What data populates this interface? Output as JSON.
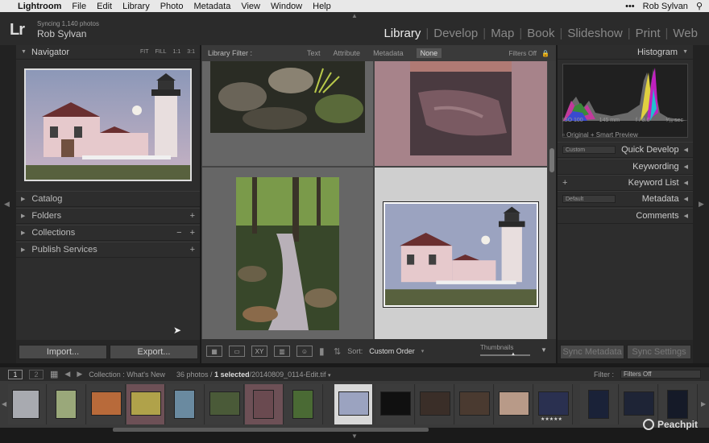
{
  "menubar": {
    "app_name": "Lightroom",
    "items": [
      "File",
      "Edit",
      "Library",
      "Photo",
      "Metadata",
      "View",
      "Window",
      "Help"
    ],
    "user": "Rob Sylvan"
  },
  "identity": {
    "sync_status": "Syncing 1,140 photos",
    "user_name": "Rob Sylvan",
    "logo": "Lr"
  },
  "modules": [
    "Library",
    "Develop",
    "Map",
    "Book",
    "Slideshow",
    "Print",
    "Web"
  ],
  "active_module": "Library",
  "left_panel": {
    "navigator_title": "Navigator",
    "zoom_options": [
      "FIT",
      "FILL",
      "1:1",
      "3:1"
    ],
    "sections": [
      {
        "label": "Catalog"
      },
      {
        "label": "Folders"
      },
      {
        "label": "Collections"
      },
      {
        "label": "Publish Services"
      }
    ],
    "import_label": "Import...",
    "export_label": "Export..."
  },
  "filter_bar": {
    "label": "Library Filter :",
    "options": [
      "Text",
      "Attribute",
      "Metadata",
      "None"
    ],
    "selected": "None",
    "status": "Filters Off"
  },
  "toolbar": {
    "sort_label": "Sort:",
    "sort_value": "Custom Order",
    "thumbnails_label": "Thumbnails"
  },
  "right_panel": {
    "histogram_title": "Histogram",
    "iso": "ISO 100",
    "focal": "145 mm",
    "aperture": "f / 8.0",
    "shutter": "¹⁄₁₆ sec",
    "preview_label": "Original + Smart Preview",
    "quick_develop_preset": "Custom",
    "quick_develop": "Quick Develop",
    "keywording": "Keywording",
    "keyword_list": "Keyword List",
    "metadata_preset": "Default",
    "metadata": "Metadata",
    "comments": "Comments",
    "sync_metadata": "Sync Metadata",
    "sync_settings": "Sync Settings"
  },
  "filmstrip_bar": {
    "page1": "1",
    "page2": "2",
    "source": "Collection : What's New",
    "count": "36 photos /",
    "selected_bold": "1 selected",
    "selected_file": "/20140809_0114-Edit.tif",
    "filter_label": "Filter :",
    "filter_value": "Filters Off"
  },
  "watermark": "Peachpit",
  "colors": {
    "accent_pink": "#a7838a",
    "panel_bg": "#2d2d2d",
    "grid_bg": "#505050",
    "selected_cell": "#cfcfcf"
  }
}
